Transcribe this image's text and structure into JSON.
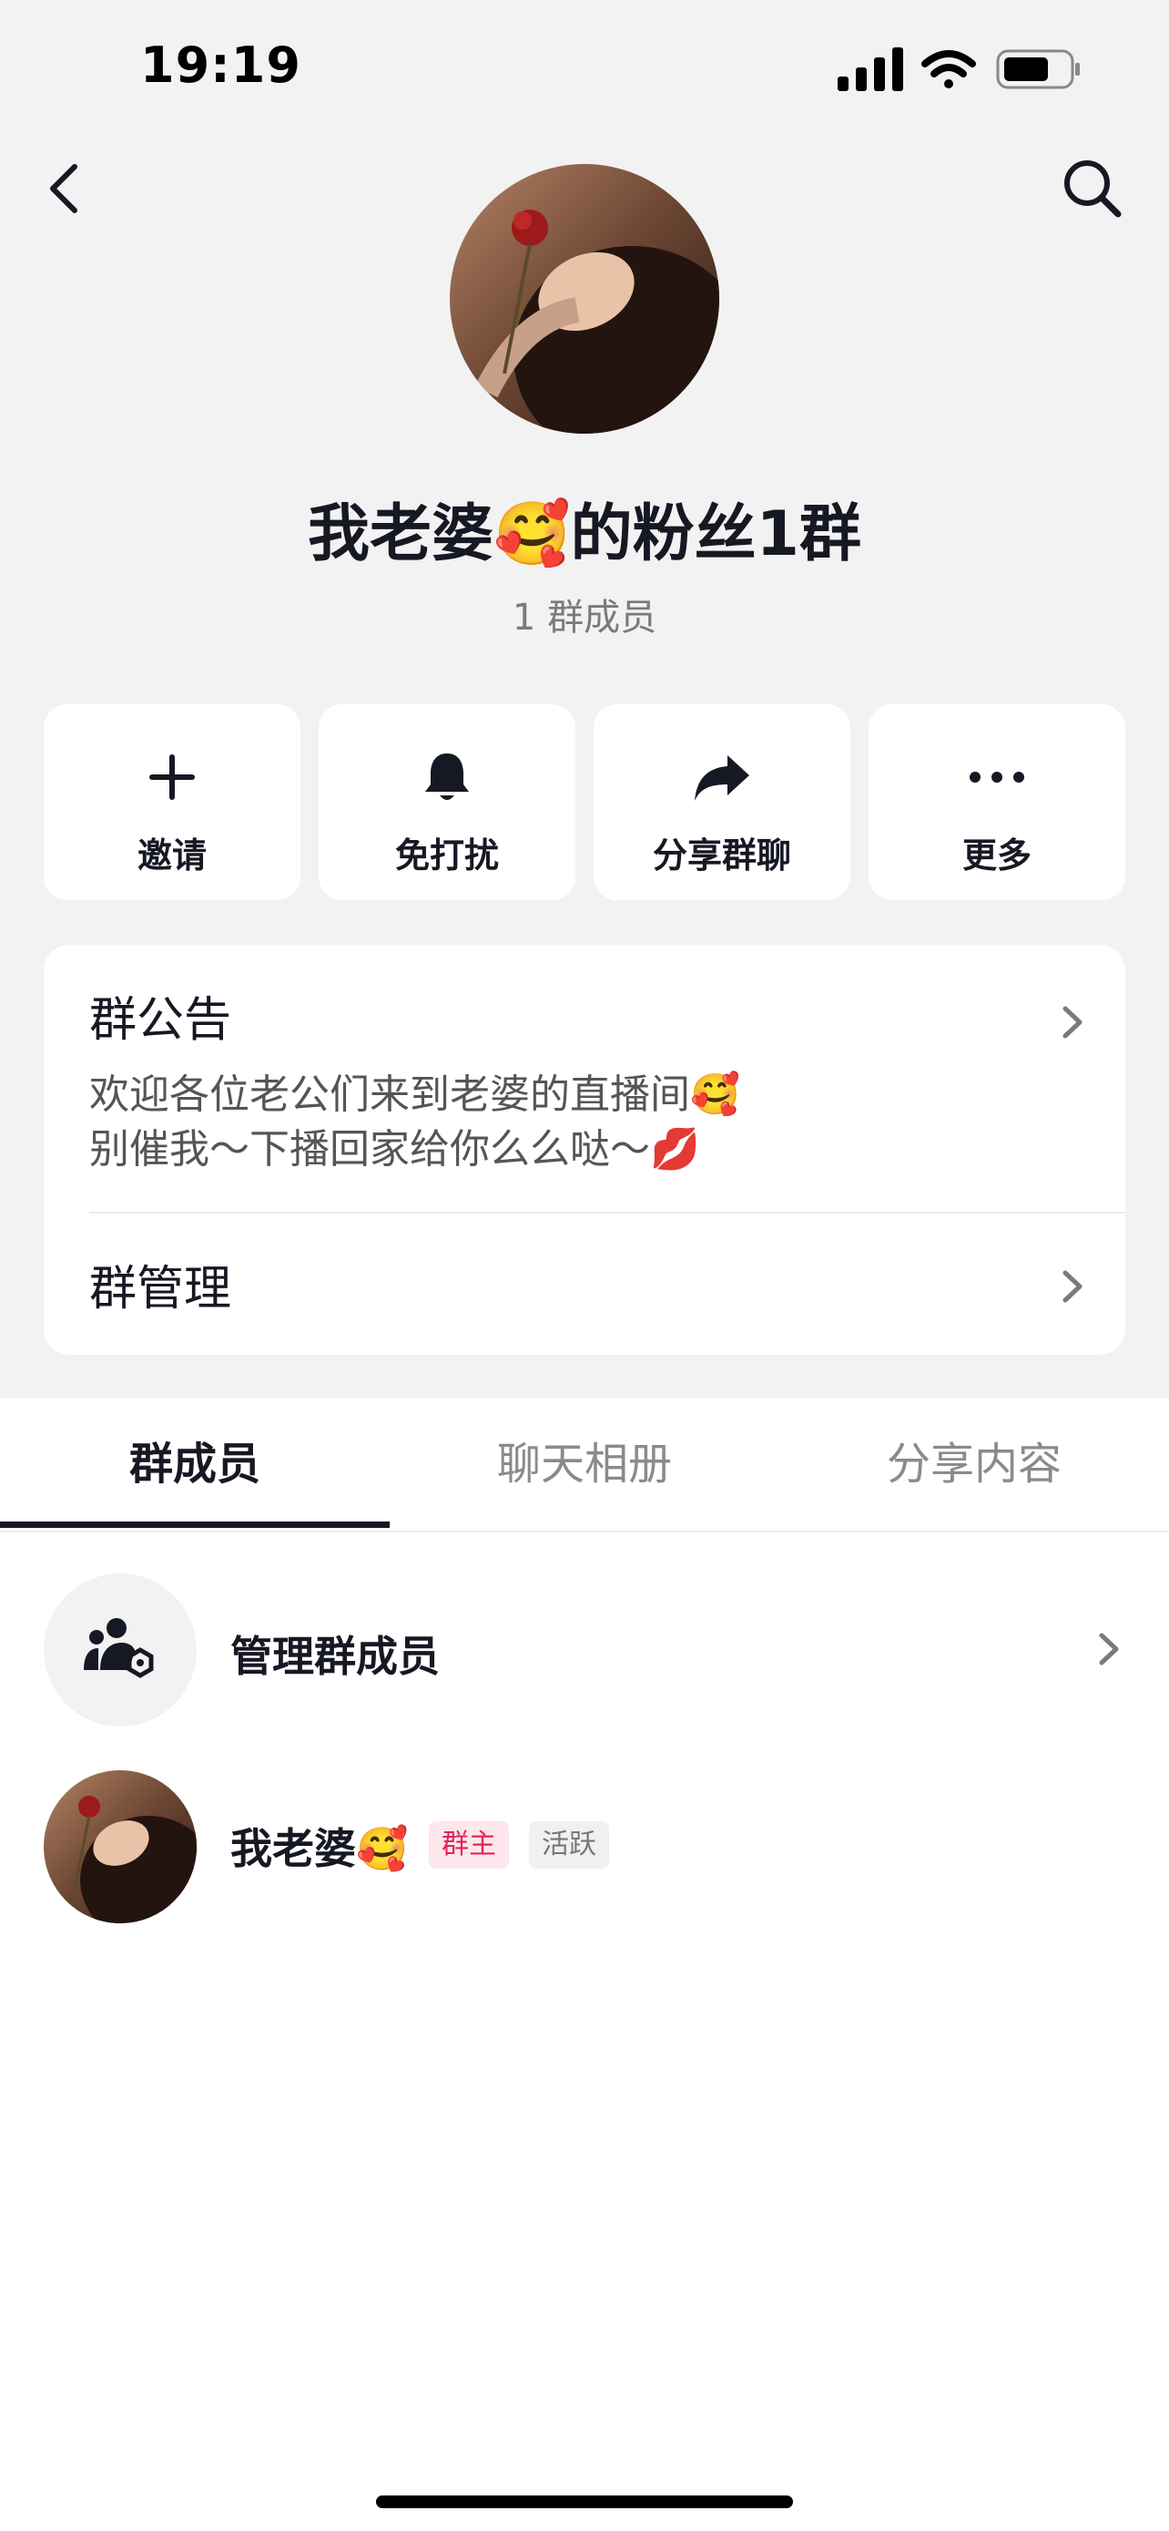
{
  "status_bar": {
    "time": "19:19"
  },
  "header": {
    "back_icon": "chevron-left-icon",
    "search_icon": "search-icon",
    "group_name": "我老婆🥰的粉丝1群",
    "member_count": "1 群成员"
  },
  "actions": [
    {
      "label": "邀请",
      "icon": "plus-icon"
    },
    {
      "label": "免打扰",
      "icon": "bell-icon"
    },
    {
      "label": "分享群聊",
      "icon": "share-icon"
    },
    {
      "label": "更多",
      "icon": "more-icon"
    }
  ],
  "notice": {
    "title": "群公告",
    "line1": "欢迎各位老公们来到老婆的直播间🥰",
    "line2": "别催我～下播回家给你么么哒～💋"
  },
  "management": {
    "title": "群管理"
  },
  "tabs": [
    {
      "label": "群成员",
      "active": true
    },
    {
      "label": "聊天相册",
      "active": false
    },
    {
      "label": "分享内容",
      "active": false
    }
  ],
  "members": {
    "manage_label": "管理群成员",
    "list": [
      {
        "name": "我老婆🥰",
        "badges": [
          "群主",
          "活跃"
        ]
      }
    ]
  },
  "colors": {
    "accent_text": "#161823",
    "owner_badge": "#e0245e",
    "background": "#f2f2f2"
  }
}
